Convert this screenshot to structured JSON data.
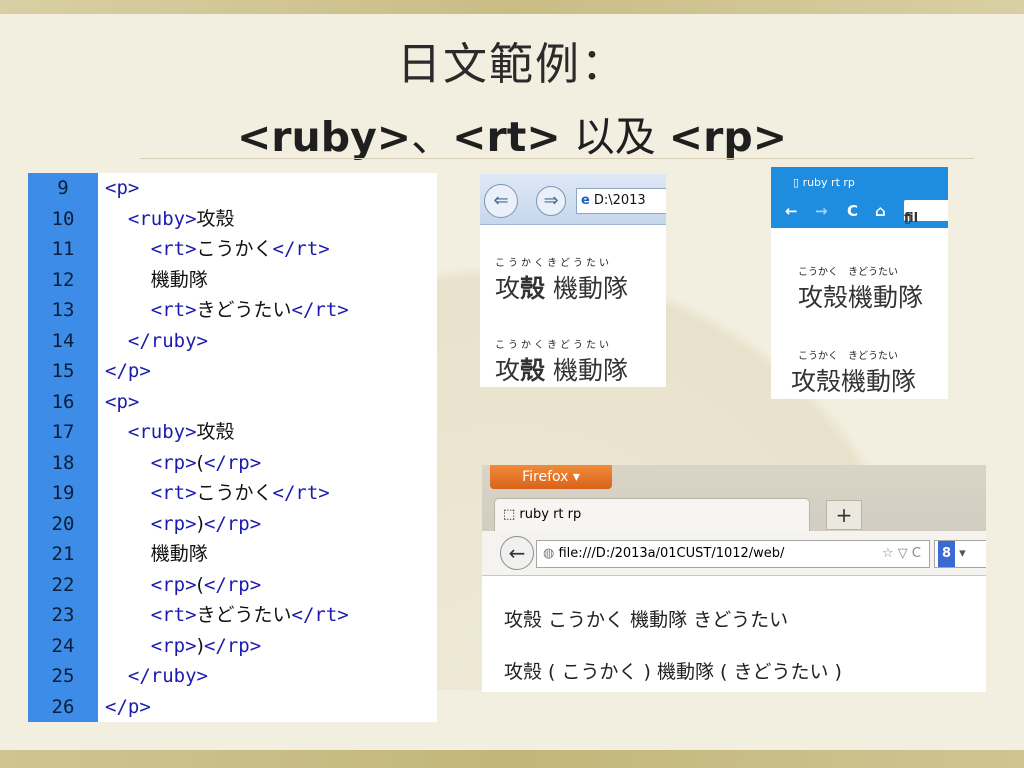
{
  "slide": {
    "title_line1": "日文範例：",
    "title_tags": [
      "<ruby>",
      "、",
      "<rt>",
      " 以及 ",
      "<rp>"
    ]
  },
  "code_lines": [
    {
      "num": "9",
      "indent": "",
      "parts": [
        {
          "t": "tag",
          "v": "<p>"
        }
      ]
    },
    {
      "num": "10",
      "indent": "  ",
      "parts": [
        {
          "t": "tag",
          "v": "<ruby>"
        },
        {
          "t": "txt",
          "v": "攻殼"
        }
      ]
    },
    {
      "num": "11",
      "indent": "    ",
      "parts": [
        {
          "t": "tag",
          "v": "<rt>"
        },
        {
          "t": "txt",
          "v": "こうかく"
        },
        {
          "t": "tag",
          "v": "</rt>"
        }
      ]
    },
    {
      "num": "12",
      "indent": "    ",
      "parts": [
        {
          "t": "txt",
          "v": "機動隊"
        }
      ]
    },
    {
      "num": "13",
      "indent": "    ",
      "parts": [
        {
          "t": "tag",
          "v": "<rt>"
        },
        {
          "t": "txt",
          "v": "きどうたい"
        },
        {
          "t": "tag",
          "v": "</rt>"
        }
      ]
    },
    {
      "num": "14",
      "indent": "  ",
      "parts": [
        {
          "t": "tag",
          "v": "</ruby>"
        }
      ]
    },
    {
      "num": "15",
      "indent": "",
      "parts": [
        {
          "t": "tag",
          "v": "</p>"
        }
      ]
    },
    {
      "num": "16",
      "indent": "",
      "parts": [
        {
          "t": "tag",
          "v": "<p>"
        }
      ]
    },
    {
      "num": "17",
      "indent": "  ",
      "parts": [
        {
          "t": "tag",
          "v": "<ruby>"
        },
        {
          "t": "txt",
          "v": "攻殼"
        }
      ]
    },
    {
      "num": "18",
      "indent": "    ",
      "parts": [
        {
          "t": "tag",
          "v": "<rp>"
        },
        {
          "t": "txt",
          "v": "("
        },
        {
          "t": "tag",
          "v": "</rp>"
        }
      ]
    },
    {
      "num": "19",
      "indent": "    ",
      "parts": [
        {
          "t": "tag",
          "v": "<rt>"
        },
        {
          "t": "txt",
          "v": "こうかく"
        },
        {
          "t": "tag",
          "v": "</rt>"
        }
      ]
    },
    {
      "num": "20",
      "indent": "    ",
      "parts": [
        {
          "t": "tag",
          "v": "<rp>"
        },
        {
          "t": "txt",
          "v": ")"
        },
        {
          "t": "tag",
          "v": "</rp>"
        }
      ]
    },
    {
      "num": "21",
      "indent": "    ",
      "parts": [
        {
          "t": "txt",
          "v": "機動隊"
        }
      ]
    },
    {
      "num": "22",
      "indent": "    ",
      "parts": [
        {
          "t": "tag",
          "v": "<rp>"
        },
        {
          "t": "txt",
          "v": "("
        },
        {
          "t": "tag",
          "v": "</rp>"
        }
      ]
    },
    {
      "num": "23",
      "indent": "    ",
      "parts": [
        {
          "t": "tag",
          "v": "<rt>"
        },
        {
          "t": "txt",
          "v": "きどうたい"
        },
        {
          "t": "tag",
          "v": "</rt>"
        }
      ]
    },
    {
      "num": "24",
      "indent": "    ",
      "parts": [
        {
          "t": "tag",
          "v": "<rp>"
        },
        {
          "t": "txt",
          "v": ")"
        },
        {
          "t": "tag",
          "v": "</rp>"
        }
      ]
    },
    {
      "num": "25",
      "indent": "  ",
      "parts": [
        {
          "t": "tag",
          "v": "</ruby>"
        }
      ]
    },
    {
      "num": "26",
      "indent": "",
      "parts": [
        {
          "t": "tag",
          "v": "</p>"
        }
      ]
    }
  ],
  "ie_shot": {
    "back_icon": "back-arrow-icon",
    "forward_icon": "forward-arrow-icon",
    "address": "D:\\2013",
    "rt_text": "こうかくきどうたい",
    "rb_text_1": "攻",
    "rb_text_bold": "殼",
    "rb_text_2": " 機動隊"
  },
  "chrome_shot": {
    "tab_title": "ruby rt rp",
    "nav_back": "←",
    "nav_forward": "→",
    "nav_reload": "C",
    "nav_home": "⌂",
    "omnibox": "fil",
    "rt_text": "こうかく　きどうたい",
    "rb_text": "攻殼機動隊"
  },
  "firefox_shot": {
    "menu_button": "Firefox ▾",
    "tab_title": "ruby rt rp",
    "new_tab": "+",
    "back": "←",
    "url": "file:///D:/2013a/01CUST/1012/web/",
    "url_controls": "☆ ▽ C",
    "search_engine": "8",
    "line1": "攻殼 こうかく 機動隊 きどうたい",
    "line2": "攻殼 ( こうかく ) 機動隊 ( きどうたい )"
  }
}
